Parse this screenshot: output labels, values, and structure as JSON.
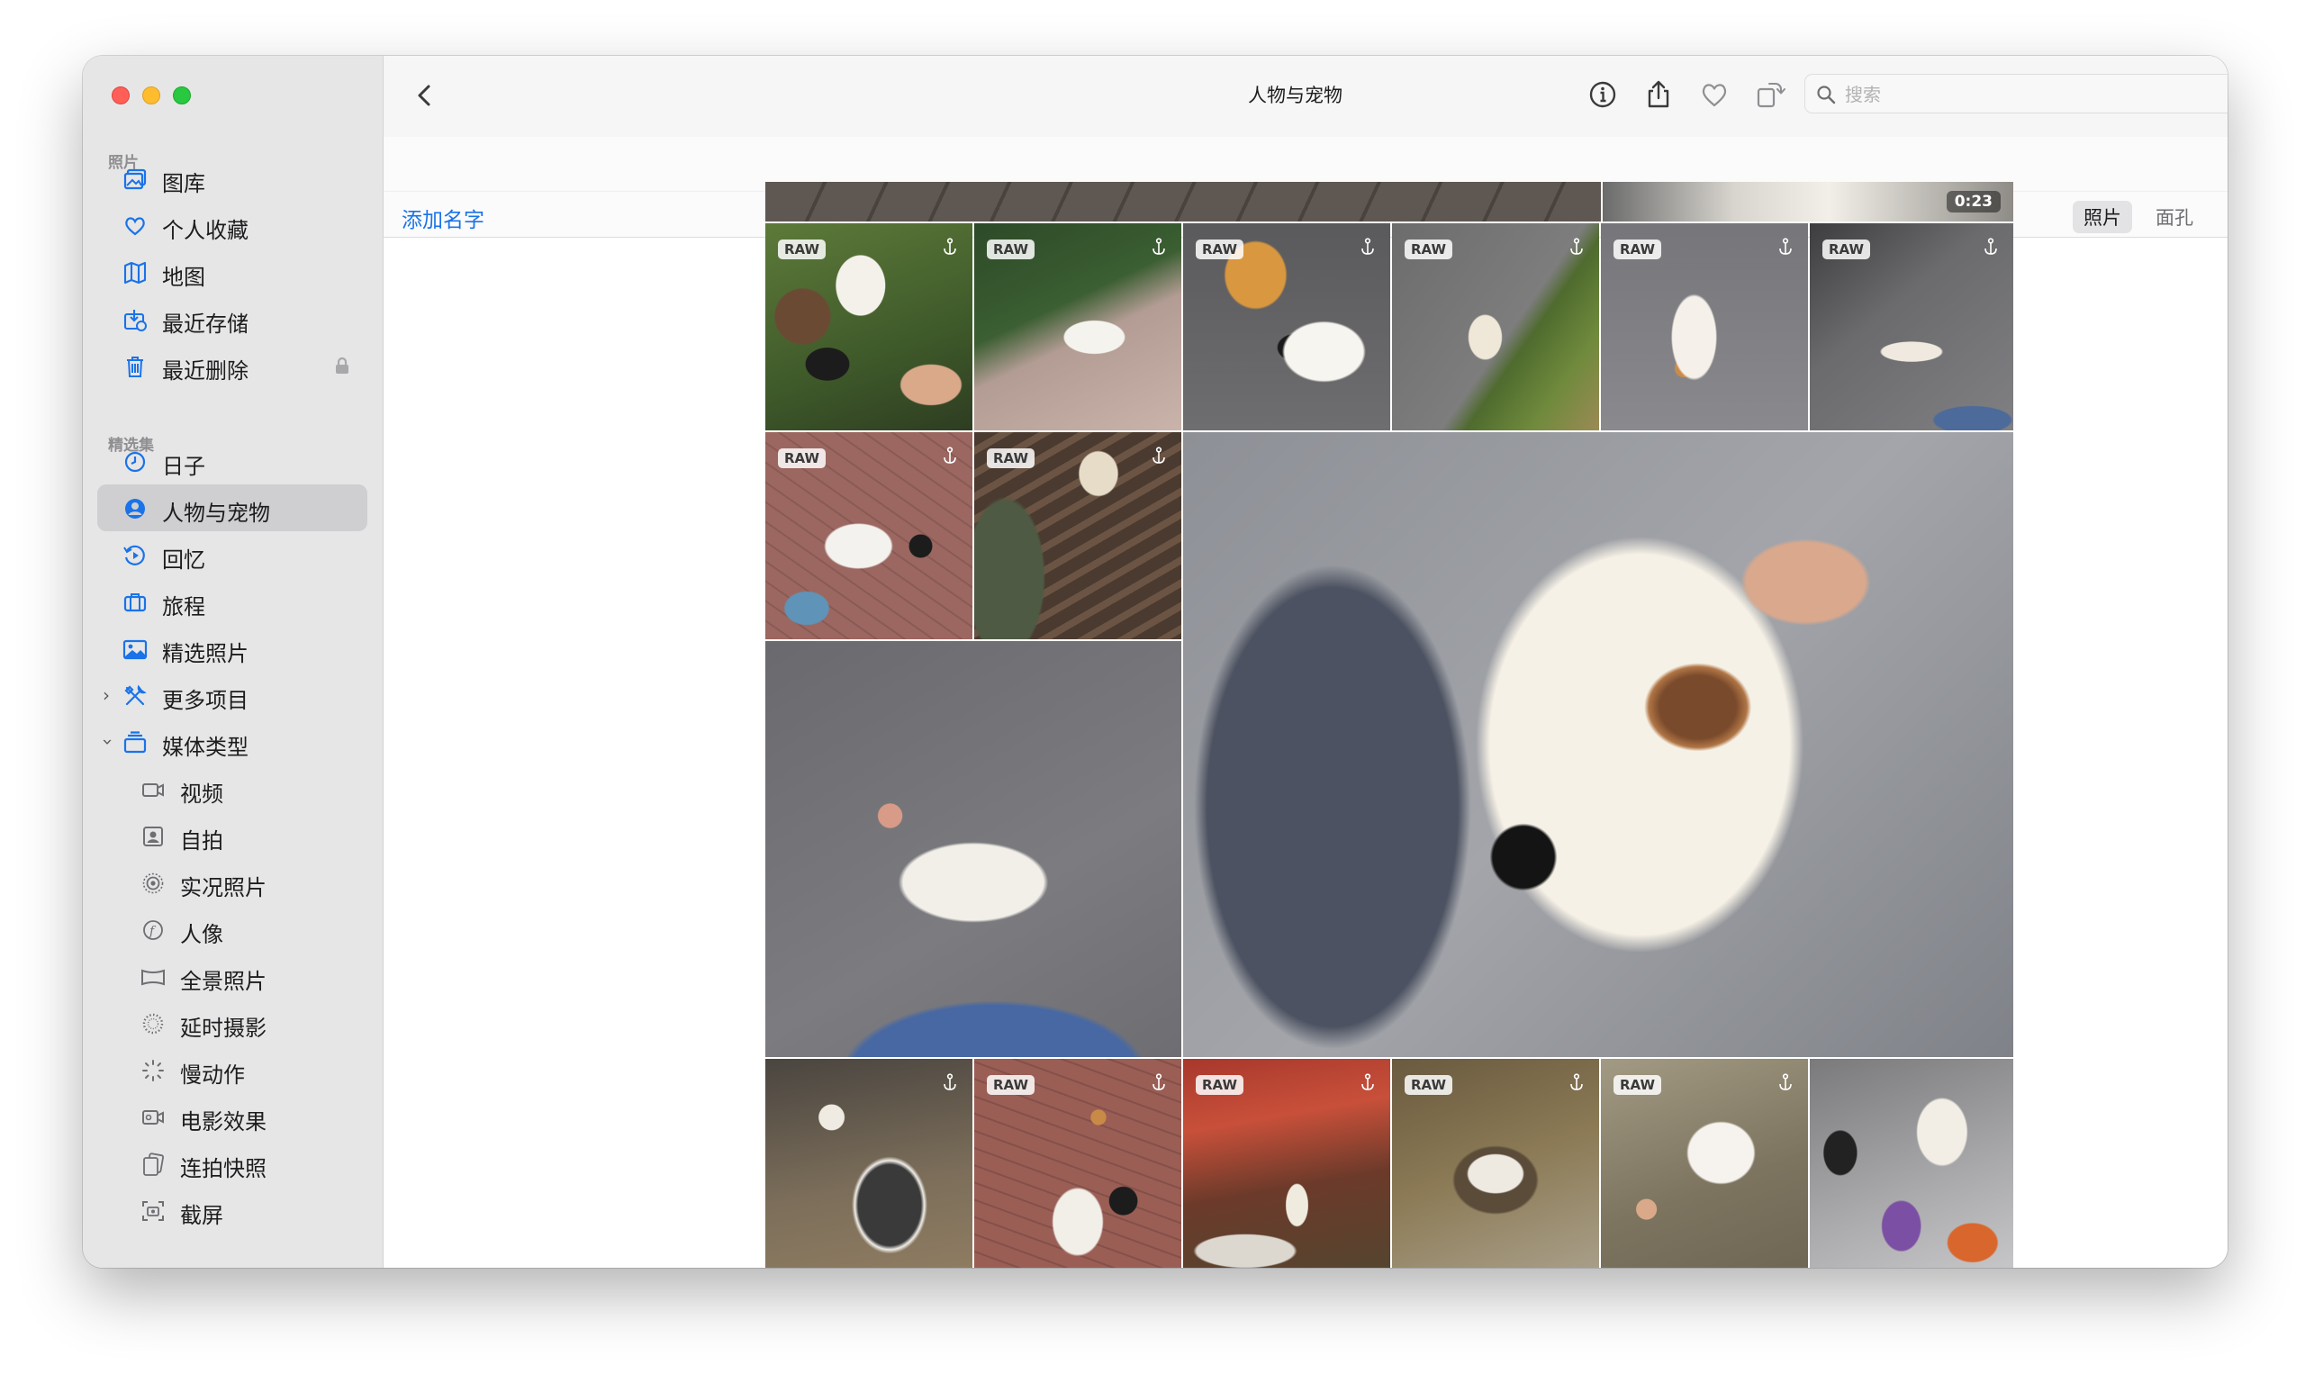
{
  "window": {
    "title": "人物与宠物"
  },
  "sidebar": {
    "section_photos": "照片",
    "photos_items": [
      {
        "label": "图库",
        "icon": "photo-library-icon"
      },
      {
        "label": "个人收藏",
        "icon": "heart-icon"
      },
      {
        "label": "地图",
        "icon": "map-icon"
      },
      {
        "label": "最近存储",
        "icon": "recently-saved-icon"
      },
      {
        "label": "最近删除",
        "icon": "trash-icon",
        "locked": true
      }
    ],
    "section_collections": "精选集",
    "collection_items": [
      {
        "label": "日子",
        "icon": "clock-icon"
      },
      {
        "label": "人物与宠物",
        "icon": "person-circle-icon",
        "selected": true
      },
      {
        "label": "回忆",
        "icon": "memories-icon"
      },
      {
        "label": "旅程",
        "icon": "suitcase-icon"
      },
      {
        "label": "精选照片",
        "icon": "featured-photos-icon"
      },
      {
        "label": "更多项目",
        "icon": "tools-icon",
        "expanded": false
      },
      {
        "label": "媒体类型",
        "icon": "stack-icon",
        "expanded": true
      }
    ],
    "media_types": [
      {
        "label": "视频",
        "icon": "video-icon"
      },
      {
        "label": "自拍",
        "icon": "selfie-icon"
      },
      {
        "label": "实况照片",
        "icon": "live-photo-icon"
      },
      {
        "label": "人像",
        "icon": "portrait-icon"
      },
      {
        "label": "全景照片",
        "icon": "panorama-icon"
      },
      {
        "label": "延时摄影",
        "icon": "timelapse-icon"
      },
      {
        "label": "慢动作",
        "icon": "slomo-icon"
      },
      {
        "label": "电影效果",
        "icon": "cinematic-icon"
      },
      {
        "label": "连拍快照",
        "icon": "burst-icon"
      },
      {
        "label": "截屏",
        "icon": "screenshot-icon"
      }
    ]
  },
  "toolbar": {
    "icons": [
      "back-icon",
      "info-icon",
      "share-icon",
      "heart-icon",
      "rotate-icon",
      "search-icon"
    ],
    "search_placeholder": "搜索"
  },
  "subbar": {
    "add_name": "添加名字",
    "segments": [
      {
        "label": "照片",
        "selected": true
      },
      {
        "label": "面孔",
        "selected": false
      }
    ]
  },
  "grid": {
    "raw_badge": "RAW",
    "video_duration": "0:23"
  },
  "colors": {
    "accent": "#1a73e8",
    "sidebar_bg": "#e6e6e7",
    "selected_row": "#cfcfd2"
  }
}
